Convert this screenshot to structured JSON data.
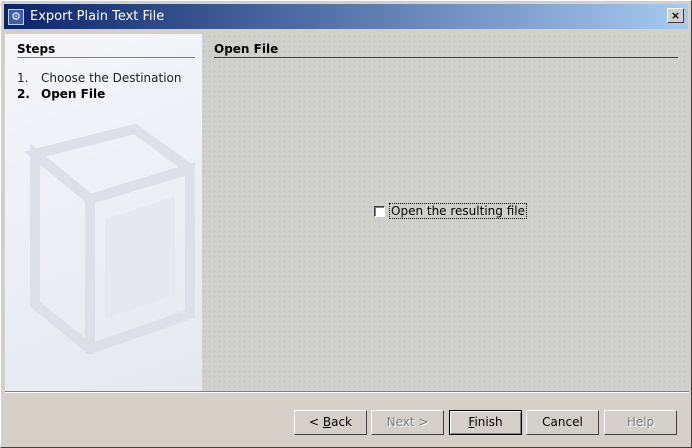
{
  "window": {
    "title": "Export Plain Text File",
    "close_glyph": "×",
    "icon": "app-icon"
  },
  "steps": {
    "title": "Steps",
    "items": [
      {
        "num": "1.",
        "label": "Choose the Destination"
      },
      {
        "num": "2.",
        "label": "Open File"
      }
    ]
  },
  "panel": {
    "title": "Open File",
    "checkbox_label": "Open the resulting file",
    "checkbox_checked": false
  },
  "buttons": {
    "back": {
      "prefix": "< ",
      "mnemonic": "B",
      "rest": "ack"
    },
    "next": "Next >",
    "finish": {
      "mnemonic": "F",
      "rest": "inish"
    },
    "cancel": "Cancel",
    "help": "Help"
  }
}
